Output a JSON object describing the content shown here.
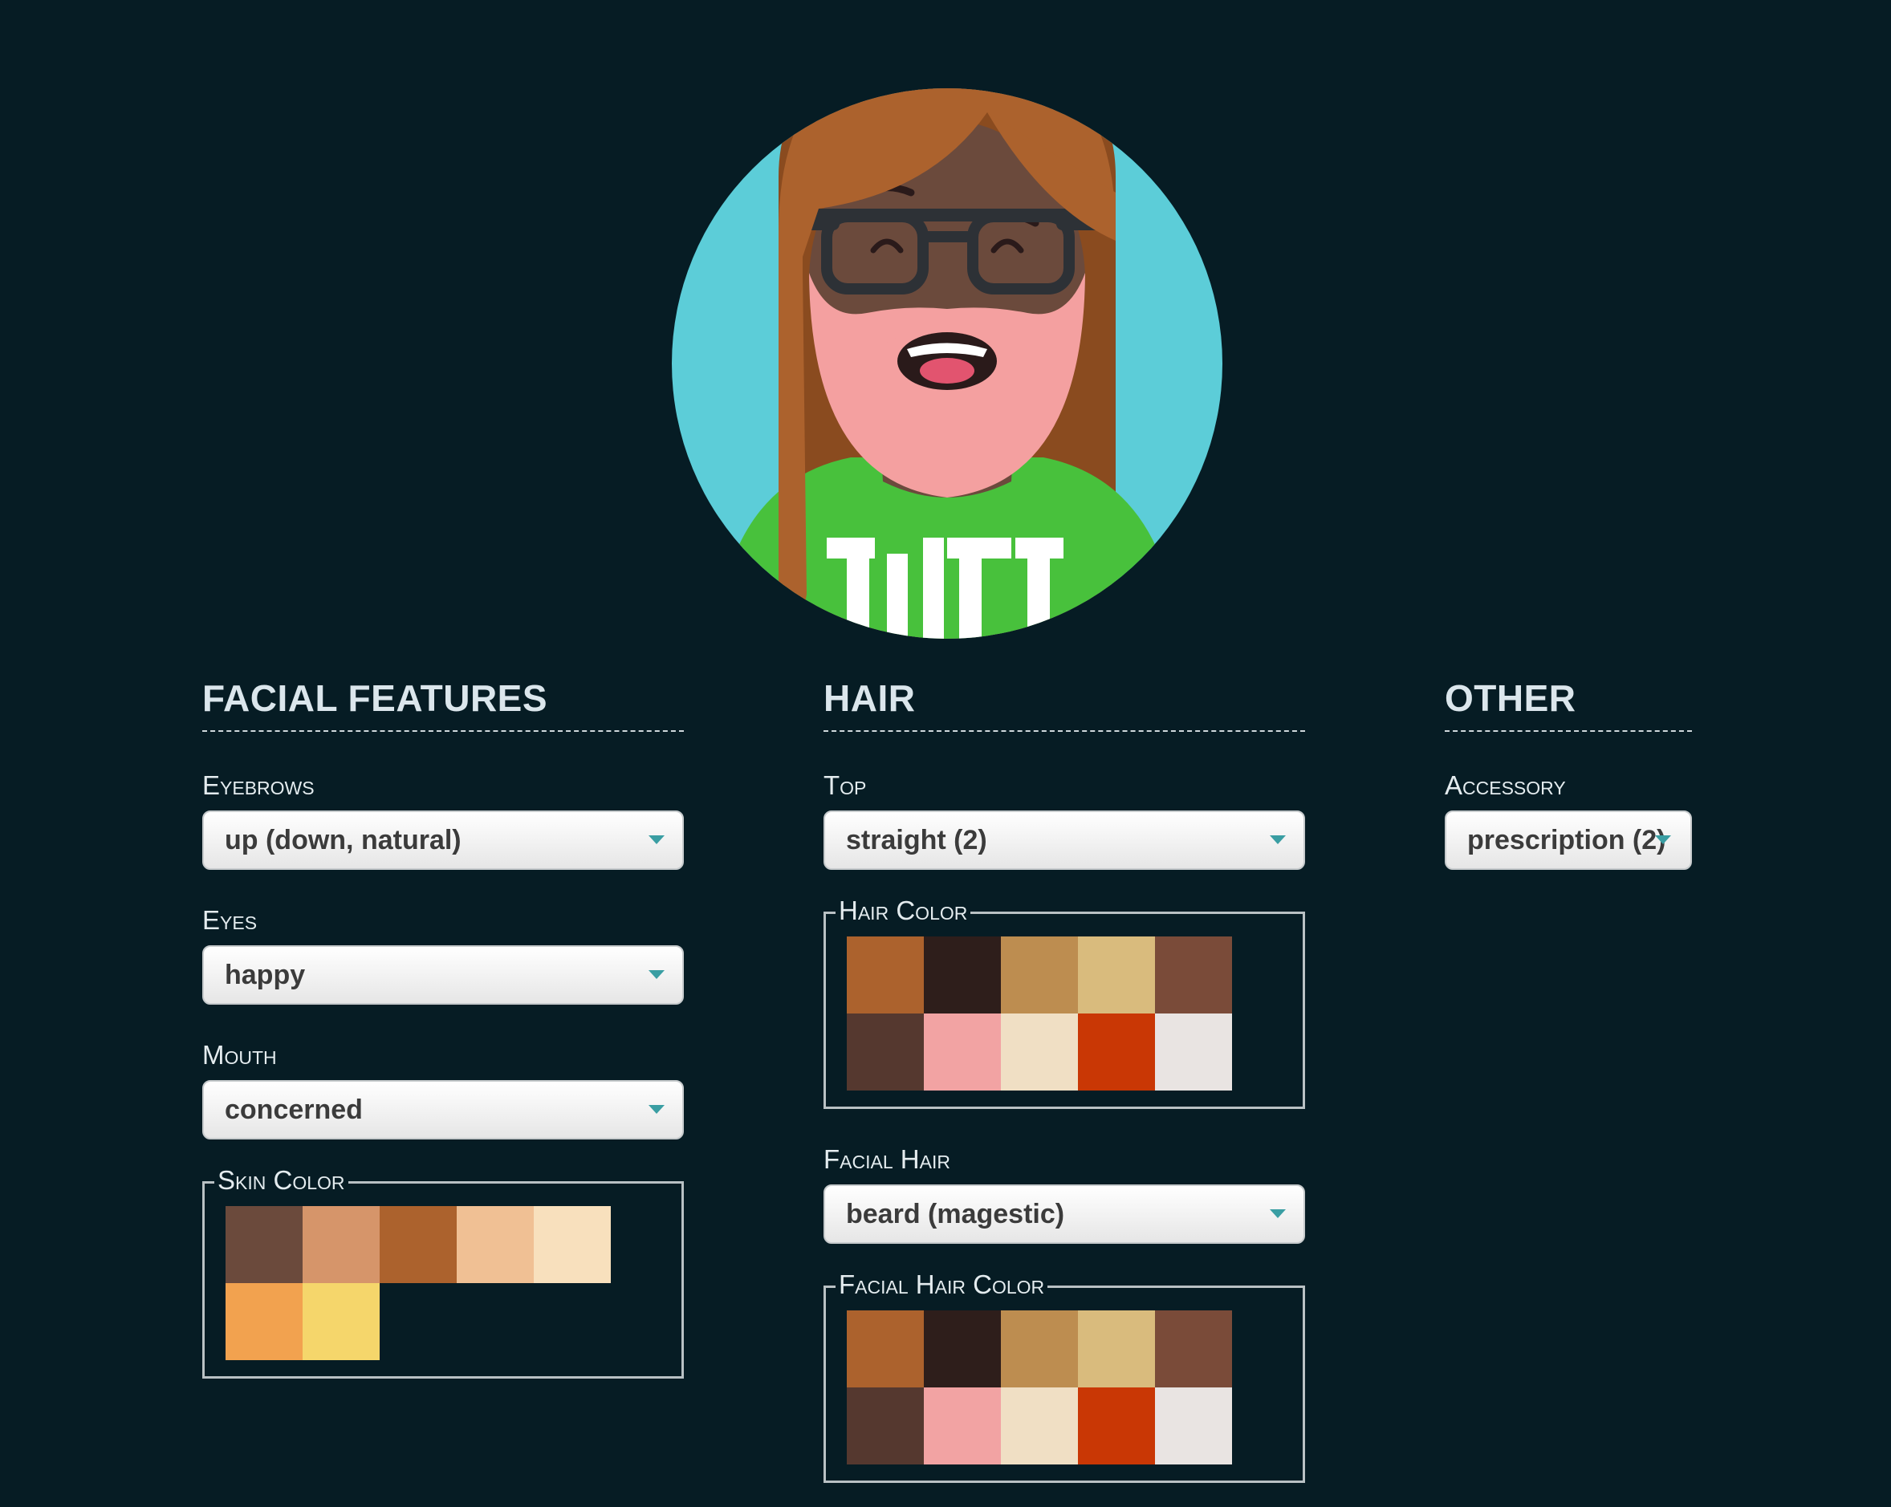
{
  "avatar": {
    "colors": {
      "background": "#5ccdd8",
      "hair": "#ac622d",
      "hair_shadow": "#8a4b1f",
      "skin": "#6b4a3c",
      "beard": "#f4a0a0",
      "shirt": "#48c13c",
      "glasses": "#2d3136",
      "mouth": "#2a1a1a",
      "tongue": "#e2546f"
    },
    "shirt_text": "TILT"
  },
  "facial_features": {
    "title": "FACIAL FEATURES",
    "eyebrows": {
      "label": "Eyebrows",
      "value": "up (down, natural)"
    },
    "eyes": {
      "label": "Eyes",
      "value": "happy"
    },
    "mouth": {
      "label": "Mouth",
      "value": "concerned"
    },
    "skin_color": {
      "label": "Skin Color",
      "swatches": [
        "#6b4a3c",
        "#d6956a",
        "#ac622d",
        "#f0c094",
        "#f8e0bd",
        "#f2a24f",
        "#f5d66b"
      ]
    }
  },
  "hair": {
    "title": "HAIR",
    "top": {
      "label": "Top",
      "value": "straight (2)"
    },
    "hair_color": {
      "label": "Hair Color",
      "swatches": [
        "#ac622d",
        "#2e1e1b",
        "#bd8d50",
        "#d9bb7d",
        "#7a4b39",
        "#55382f",
        "#f2a3a3",
        "#f0dfc4",
        "#c93705",
        "#e9e4e2"
      ]
    },
    "facial_hair": {
      "label": "Facial Hair",
      "value": "beard (magestic)"
    },
    "facial_hair_color": {
      "label": "Facial Hair Color",
      "swatches": [
        "#ac622d",
        "#2e1e1b",
        "#bd8d50",
        "#d9bb7d",
        "#7a4b39",
        "#55382f",
        "#f2a3a3",
        "#f0dfc4",
        "#c93705",
        "#e9e4e2"
      ]
    }
  },
  "other": {
    "title": "OTHER",
    "accessory": {
      "label": "Accessory",
      "value": "prescription (2)"
    }
  }
}
